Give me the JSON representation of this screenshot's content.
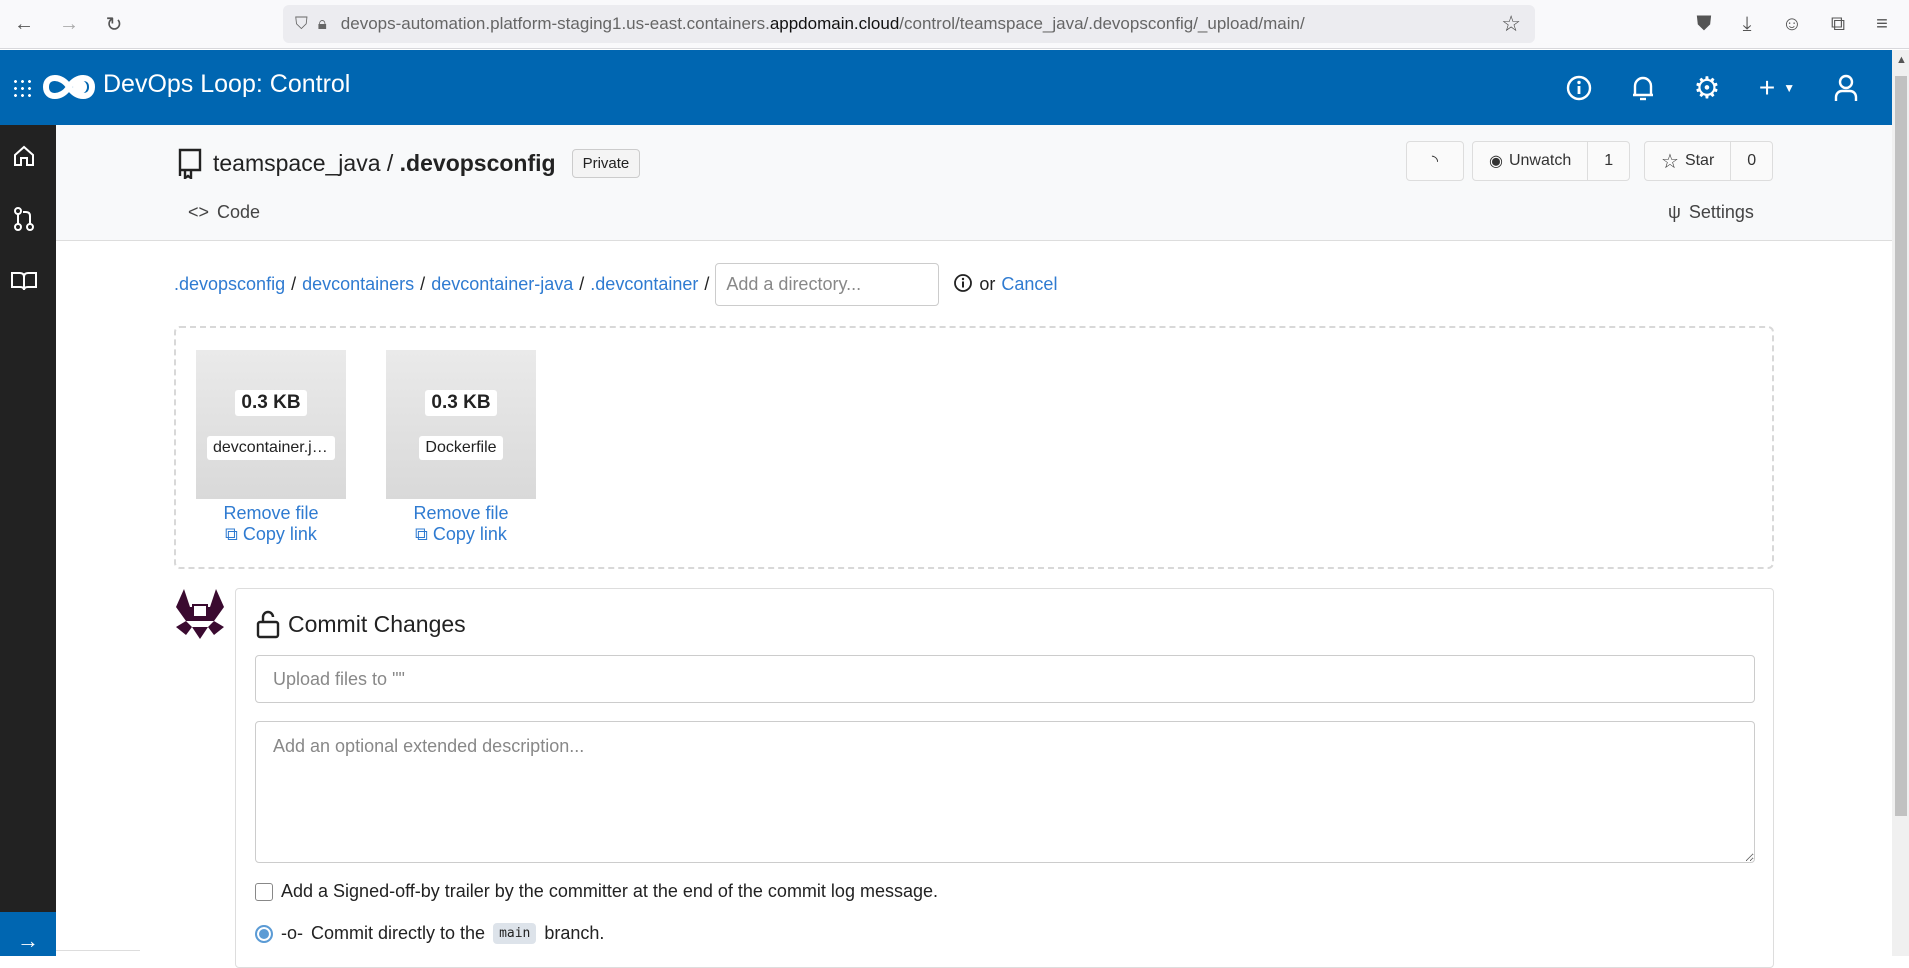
{
  "browser": {
    "url_prefix": "devops-automation.platform-staging1.us-east.containers.",
    "url_domain": "appdomain.cloud",
    "url_suffix": "/control/teamspace_java/.devopsconfig/_upload/main/"
  },
  "app": {
    "title": "DevOps Loop: Control",
    "brand_color": "#0066b1"
  },
  "repo": {
    "owner": "teamspace_java",
    "separator": " / ",
    "name": ".devopsconfig",
    "visibility": "Private",
    "watch_label": "Unwatch",
    "watch_count": "1",
    "star_label": "Star",
    "star_count": "0"
  },
  "tabs": {
    "code": "Code",
    "settings": "Settings"
  },
  "breadcrumb": {
    "items": [
      ".devopsconfig",
      "devcontainers",
      "devcontainer-java",
      ".devcontainer"
    ],
    "sep": "/",
    "dir_placeholder": "Add a directory...",
    "or": "or",
    "cancel": "Cancel"
  },
  "files": [
    {
      "size": "0.3 KB",
      "name": "devcontainer.json",
      "remove": "Remove file",
      "copy": "Copy link"
    },
    {
      "size": "0.3 KB",
      "name": "Dockerfile",
      "remove": "Remove file",
      "copy": "Copy link"
    }
  ],
  "commit": {
    "title": "Commit Changes",
    "message_placeholder": "Upload files to \"\"",
    "description_placeholder": "Add an optional extended description...",
    "signoff_label": "Add a Signed-off-by trailer by the committer at the end of the commit log message.",
    "direct_prefix": "Commit directly to the",
    "branch": "main",
    "direct_suffix": "branch."
  }
}
